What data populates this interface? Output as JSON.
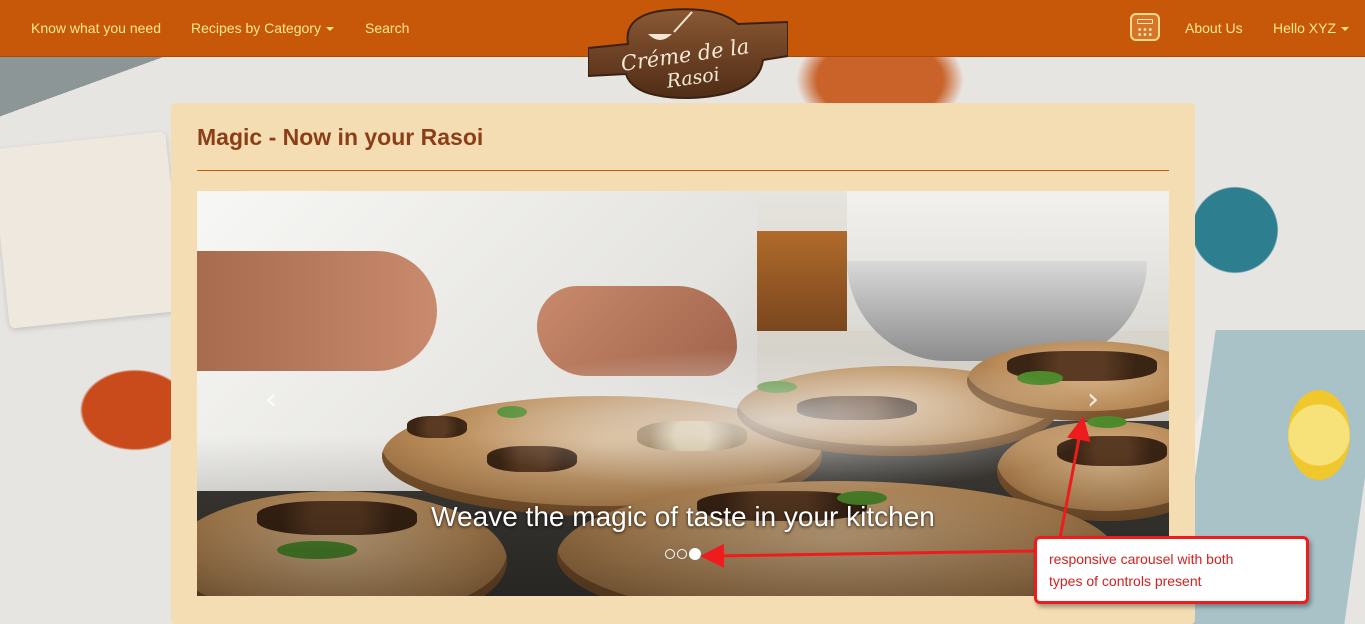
{
  "navbar": {
    "left_items": [
      {
        "label": "Know what you need"
      },
      {
        "label": "Recipes by Category",
        "has_dropdown": true
      },
      {
        "label": "Search"
      }
    ],
    "calculator_icon": "calculator-icon",
    "right_items": [
      {
        "label": "About Us"
      },
      {
        "label": "Hello XYZ",
        "has_dropdown": true
      }
    ],
    "colors": {
      "background": "#c7580a",
      "link": "#ffe88a"
    }
  },
  "logo": {
    "line1": "Créme de la",
    "line2": "Rasoi"
  },
  "panel": {
    "title": "Magic - Now in your Rasoi"
  },
  "carousel": {
    "caption": "Weave the magic of taste in your kitchen",
    "prev_icon": "chevron-left-icon",
    "next_icon": "chevron-right-icon",
    "slide_count": 3,
    "active_index": 2
  },
  "annotation": {
    "text_line1": "responsive carousel with both",
    "text_line2": "types of controls present",
    "color": "#ee1c1c"
  }
}
